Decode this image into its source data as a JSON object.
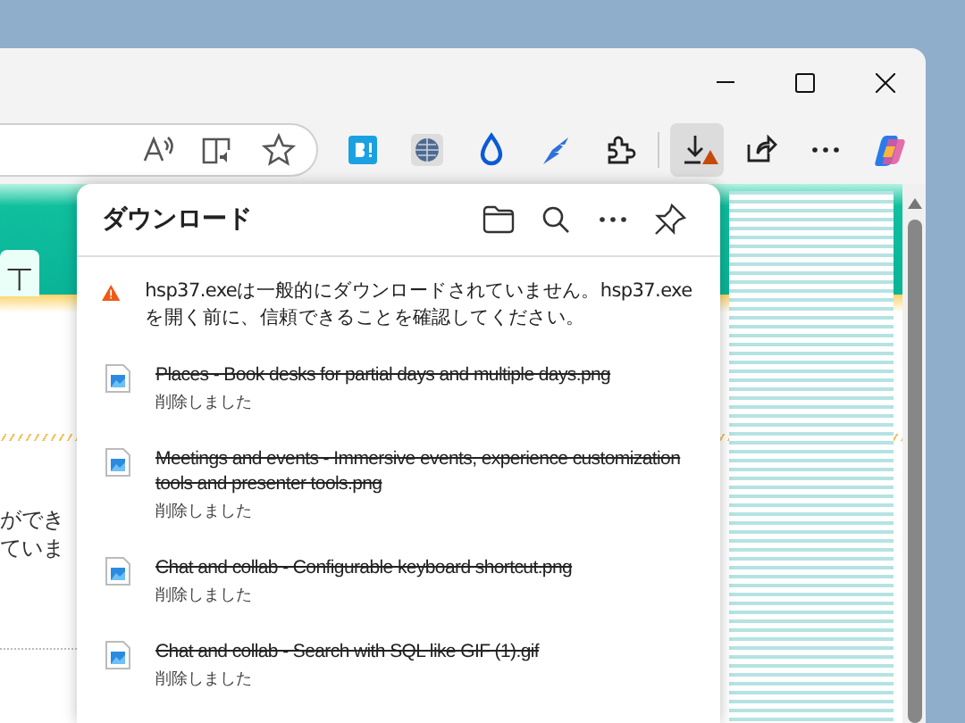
{
  "toolbar": {
    "downloads_button": {
      "active": true,
      "warning": true
    }
  },
  "page": {
    "tab_label": "丅",
    "text_lines": [
      "ができ",
      "ていま"
    ]
  },
  "downloads": {
    "title": "ダウンロード",
    "warning": "hsp37.exeは一般的にダウンロードされていません。hsp37.exeを開く前に、信頼できることを確認してください。",
    "items": [
      {
        "name": "Places - Book desks for partial days and multiple days.png",
        "status": "削除しました",
        "deleted": true
      },
      {
        "name": "Meetings and events - Immersive events, experience customization tools and presenter tools.png",
        "status": "削除しました",
        "deleted": true
      },
      {
        "name": "Chat and collab - Configurable keyboard shortcut.png",
        "status": "削除しました",
        "deleted": true
      },
      {
        "name": "Chat and collab - Search with SQL like GIF (1).gif",
        "status": "削除しました",
        "deleted": true
      }
    ]
  }
}
